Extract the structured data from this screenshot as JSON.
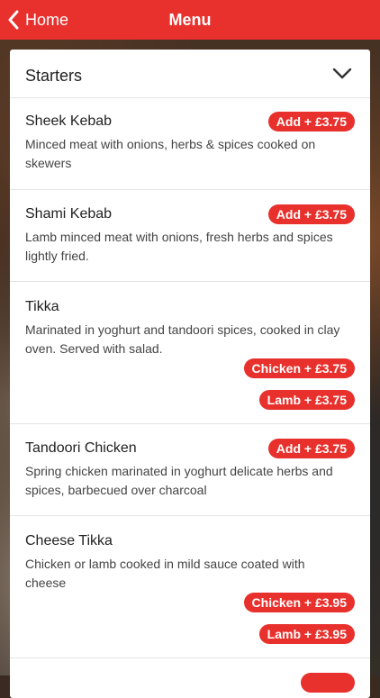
{
  "colors": {
    "accent": "#e8302c",
    "card": "#ffffff"
  },
  "navbar": {
    "back_icon": "chevron-left-icon",
    "back_label": "Home",
    "title": "Menu"
  },
  "section": {
    "title": "Starters",
    "toggle_icon": "chevron-down-icon"
  },
  "items": [
    {
      "name": "Sheek Kebab",
      "description": "Minced meat with onions, herbs & spices cooked on skewers",
      "prices": [
        "Add + £3.75"
      ]
    },
    {
      "name": "Shami Kebab",
      "description": "Lamb minced meat with onions, fresh herbs and spices lightly fried.",
      "prices": [
        "Add + £3.75"
      ]
    },
    {
      "name": "Tikka",
      "description": "Marinated in yoghurt and tandoori spices, cooked in clay oven. Served with salad.",
      "prices": [
        "Chicken + £3.75",
        "Lamb + £3.75"
      ]
    },
    {
      "name": "Tandoori Chicken",
      "description": "Spring chicken marinated in yoghurt delicate herbs and spices, barbecued over charcoal",
      "prices": [
        "Add + £3.75"
      ]
    },
    {
      "name": "Cheese Tikka",
      "description": "Chicken or lamb cooked in mild sauce coated with cheese",
      "prices": [
        "Chicken + £3.95",
        "Lamb + £3.95"
      ]
    }
  ]
}
